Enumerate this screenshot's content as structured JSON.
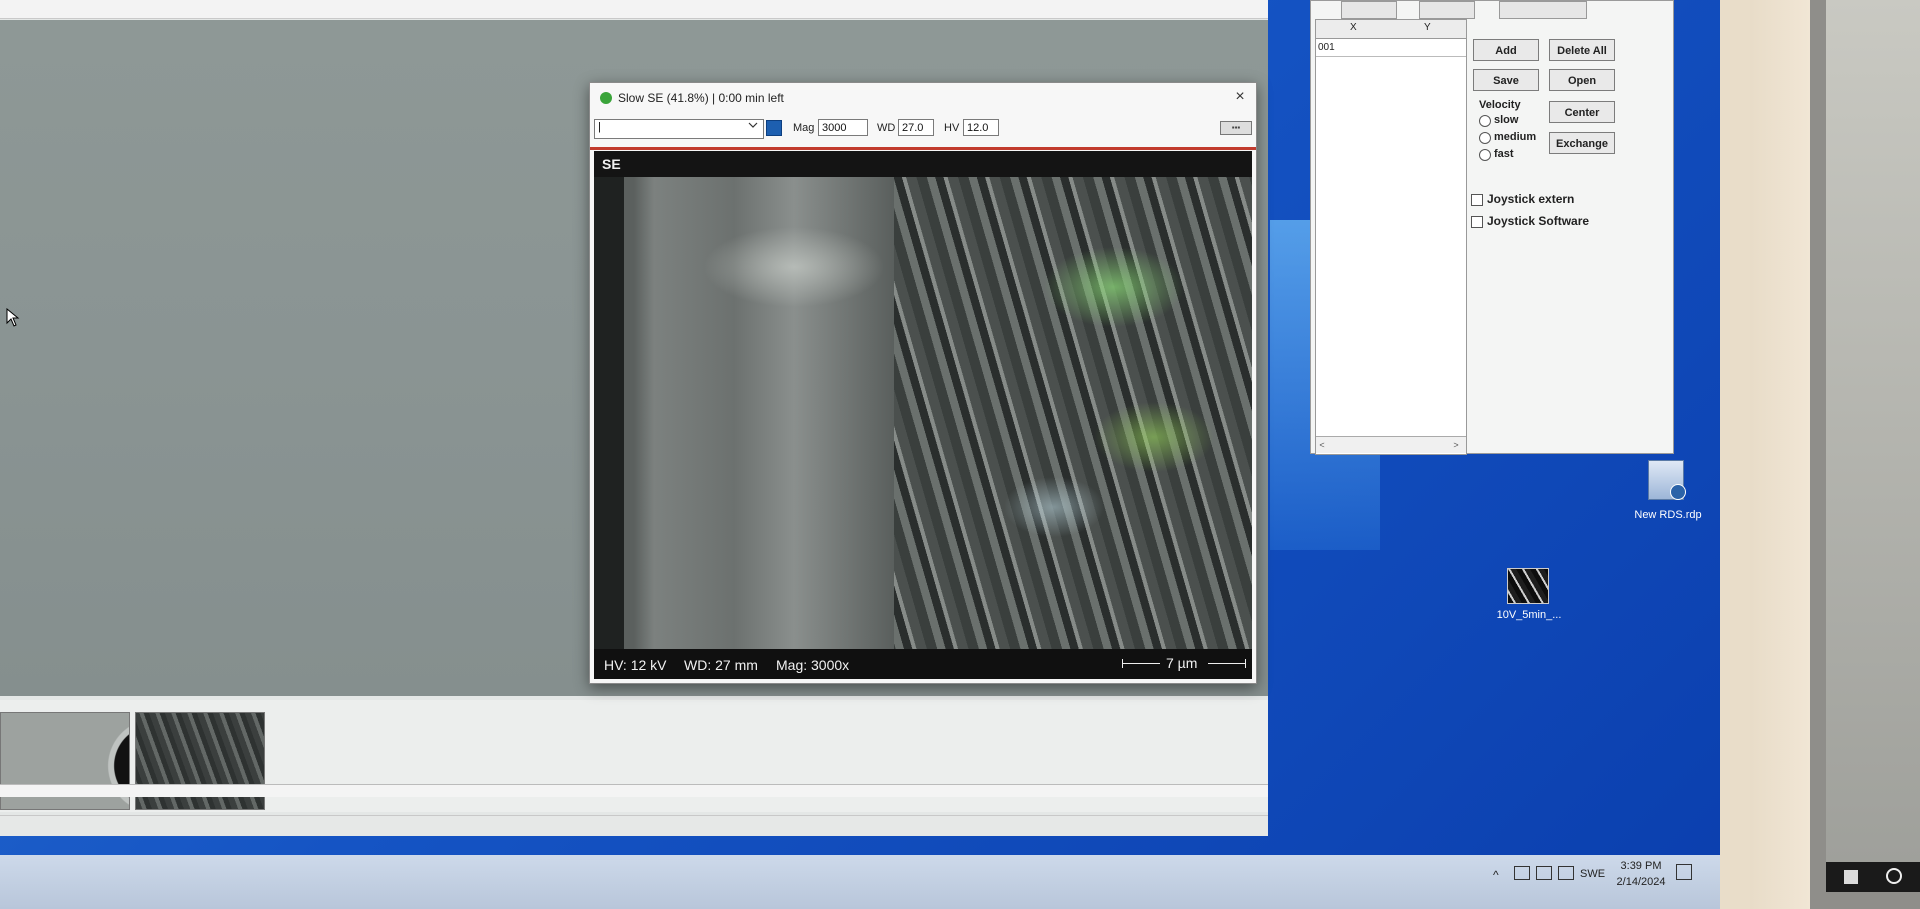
{
  "sem_window": {
    "title": "Slow SE (41.8%) | 0:00 min left",
    "close_glyph": "×",
    "toolbar": {
      "detector_value": "|",
      "mag_label": "Mag",
      "mag_value": "3000",
      "wd_label": "WD",
      "wd_value": "27.0",
      "hv_label": "HV",
      "hv_value": "12.0"
    },
    "image_label": "SE",
    "info": {
      "hv": "HV: 12 kV",
      "wd": "WD: 27 mm",
      "mag": "Mag: 3000x",
      "scale": "7 µm"
    }
  },
  "stage_panel": {
    "table": {
      "col_x": "X",
      "col_y": "Y",
      "rows": [
        {
          "id": "001"
        }
      ]
    },
    "buttons": {
      "add": "Add",
      "delete_all": "Delete All",
      "save": "Save",
      "open": "Open",
      "center": "Center",
      "exchange": "Exchange"
    },
    "velocity": {
      "label": "Velocity",
      "options": [
        "slow",
        "medium",
        "fast"
      ]
    },
    "checkboxes": {
      "joystick_extern": "Joystick extern",
      "joystick_software": "Joystick Software"
    }
  },
  "desktop": {
    "icons": [
      {
        "label": "New RDS.rdp",
        "icon": "rdp-file-icon"
      },
      {
        "label": "10V_5min_...",
        "icon": "image-file-icon"
      }
    ]
  },
  "taskbar": {
    "tray_chevron": "^",
    "language": "SWE",
    "time": "3:39 PM",
    "date": "2/14/2024"
  },
  "colors": {
    "desktop_blue": "#1554c4",
    "sem_status_green": "#3aa43a",
    "sem_divider_red": "#c23b2d"
  }
}
